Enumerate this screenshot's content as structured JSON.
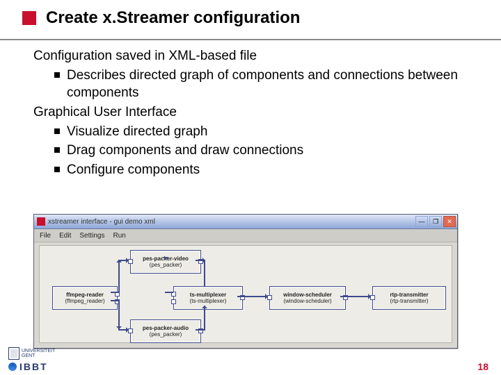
{
  "title": "Create x.Streamer configuration",
  "body": {
    "p1": "Configuration saved in XML-based file",
    "b1": "Describes directed graph of components and connections between components",
    "p2": "Graphical User Interface",
    "b2": "Visualize directed graph",
    "b3": "Drag components and draw connections",
    "b4": "Configure components"
  },
  "window": {
    "title": "xstreamer interface - gui  demo xml",
    "menu": {
      "file": "File",
      "edit": "Edit",
      "settings": "Settings",
      "run": "Run"
    },
    "nodes": {
      "video": {
        "name": "pes-packer-video",
        "sub": "(pes_packer)"
      },
      "audio": {
        "name": "pes-packer-audio",
        "sub": "(pes_packer)"
      },
      "reader": {
        "name": "ffmpeg-reader",
        "sub": "(ffmpeg_reader)"
      },
      "mux": {
        "name": "ts-multiplexer",
        "sub": "(ts-multiplexer)"
      },
      "sched": {
        "name": "window-scheduler",
        "sub": "(window-scheduler)"
      },
      "trans": {
        "name": "rtp-transmitter",
        "sub": "(rtp-transmitter)"
      }
    },
    "buttons": {
      "min": "—",
      "max": "❐",
      "close": "✕"
    }
  },
  "footer": {
    "page": "18",
    "l1a": "UNIVERSITEIT",
    "l1b": "GENT",
    "l2": "IBBT"
  }
}
